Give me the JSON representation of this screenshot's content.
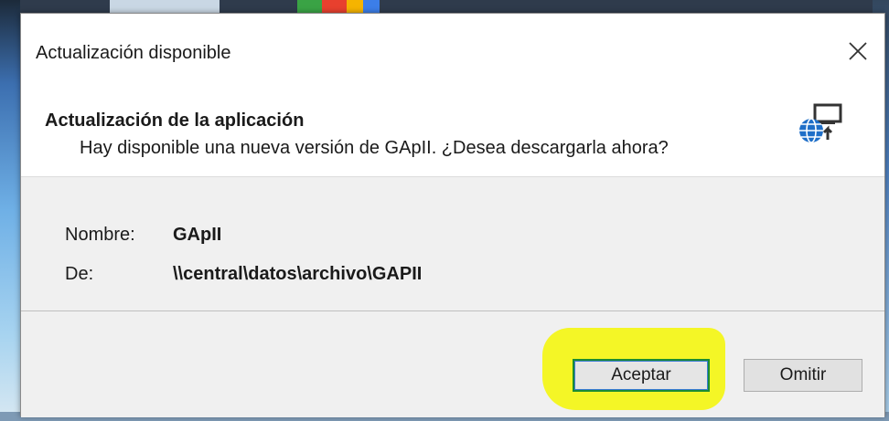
{
  "window": {
    "title": "Actualización disponible",
    "close_symbol": "✕"
  },
  "header": {
    "title": "Actualización de la aplicación",
    "subtitle": "Hay disponible una nueva versión de GApII. ¿Desea descargarla ahora?",
    "icon": "globe-update-icon"
  },
  "info": {
    "name_label": "Nombre:",
    "name_value": "GApII",
    "from_label": "De:",
    "from_value": "\\\\central\\datos\\archivo\\GAPII"
  },
  "buttons": {
    "accept_label": "Aceptar",
    "skip_label": "Omitir"
  },
  "colors": {
    "highlight": "#f3f51a",
    "accept_border": "#1c8c34",
    "icon_blue": "#1f6fc8"
  }
}
